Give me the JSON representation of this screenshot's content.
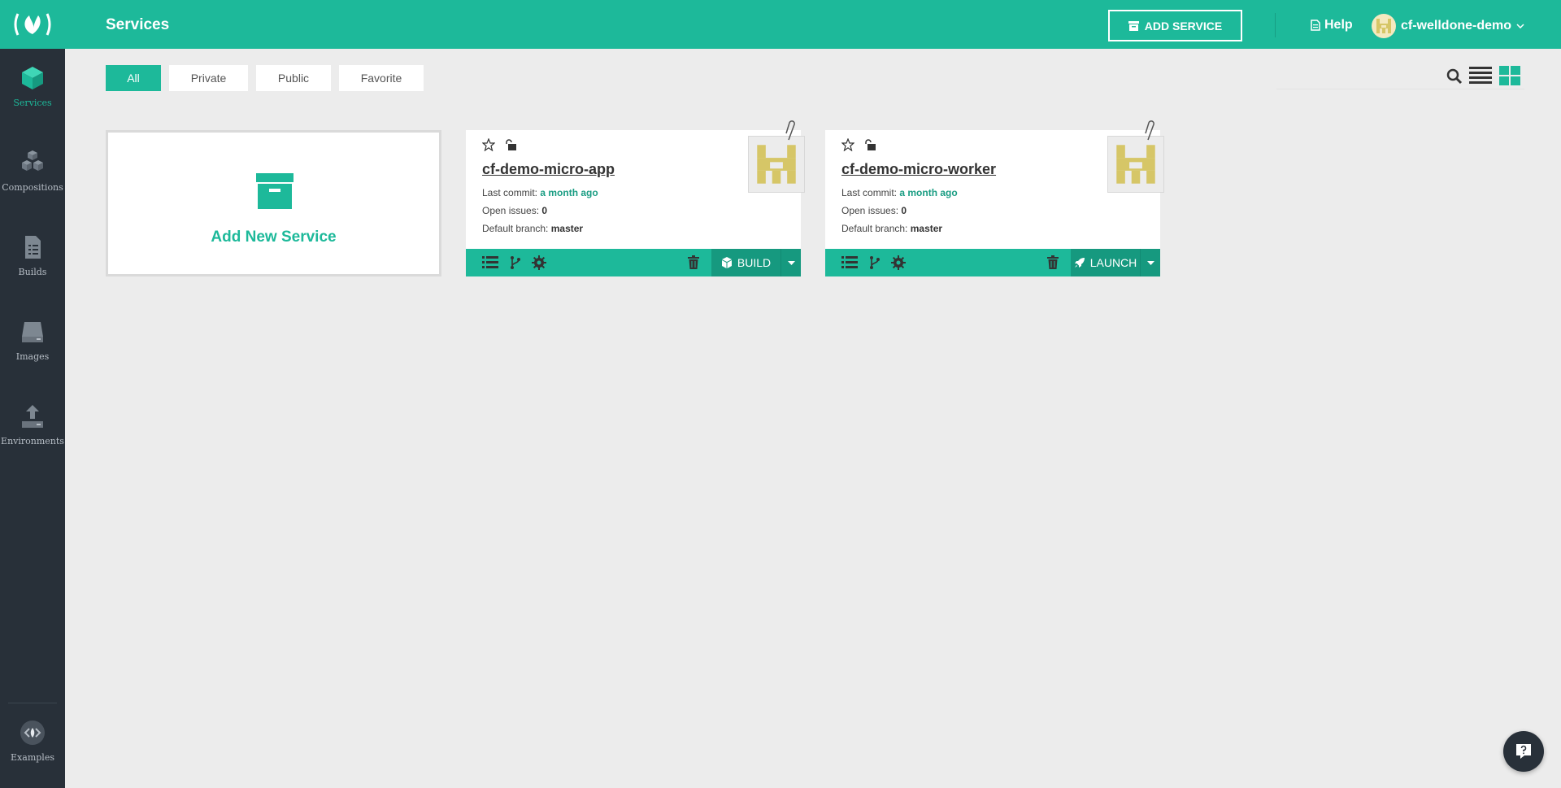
{
  "sidebar": {
    "items": [
      {
        "label": "Services",
        "icon": "cube-icon",
        "active": true
      },
      {
        "label": "Compositions",
        "icon": "cubes-icon",
        "active": false
      },
      {
        "label": "Builds",
        "icon": "document-icon",
        "active": false
      },
      {
        "label": "Images",
        "icon": "drive-icon",
        "active": false
      },
      {
        "label": "Environments",
        "icon": "upload-icon",
        "active": false
      }
    ],
    "footer_item": {
      "label": "Examples",
      "icon": "code-icon"
    }
  },
  "header": {
    "title": "Services",
    "add_service_label": "ADD SERVICE",
    "help_label": "Help",
    "user_name": "cf-welldone-demo"
  },
  "filters": {
    "tabs": [
      "All",
      "Private",
      "Public",
      "Favorite"
    ],
    "active": "All"
  },
  "add_card": {
    "label": "Add New Service"
  },
  "services": [
    {
      "name": "cf-demo-micro-app",
      "last_commit_label": "Last commit:",
      "last_commit": "a month ago",
      "open_issues_label": "Open issues:",
      "open_issues": "0",
      "default_branch_label": "Default branch:",
      "default_branch": "master",
      "action": "BUILD",
      "action_icon": "cube-icon"
    },
    {
      "name": "cf-demo-micro-worker",
      "last_commit_label": "Last commit:",
      "last_commit": "a month ago",
      "open_issues_label": "Open issues:",
      "open_issues": "0",
      "default_branch_label": "Default branch:",
      "default_branch": "master",
      "action": "LAUNCH",
      "action_icon": "rocket-icon"
    }
  ],
  "colors": {
    "accent": "#1db99a",
    "accent_dark": "#16997f",
    "sidebar": "#283039",
    "background": "#ececec"
  }
}
